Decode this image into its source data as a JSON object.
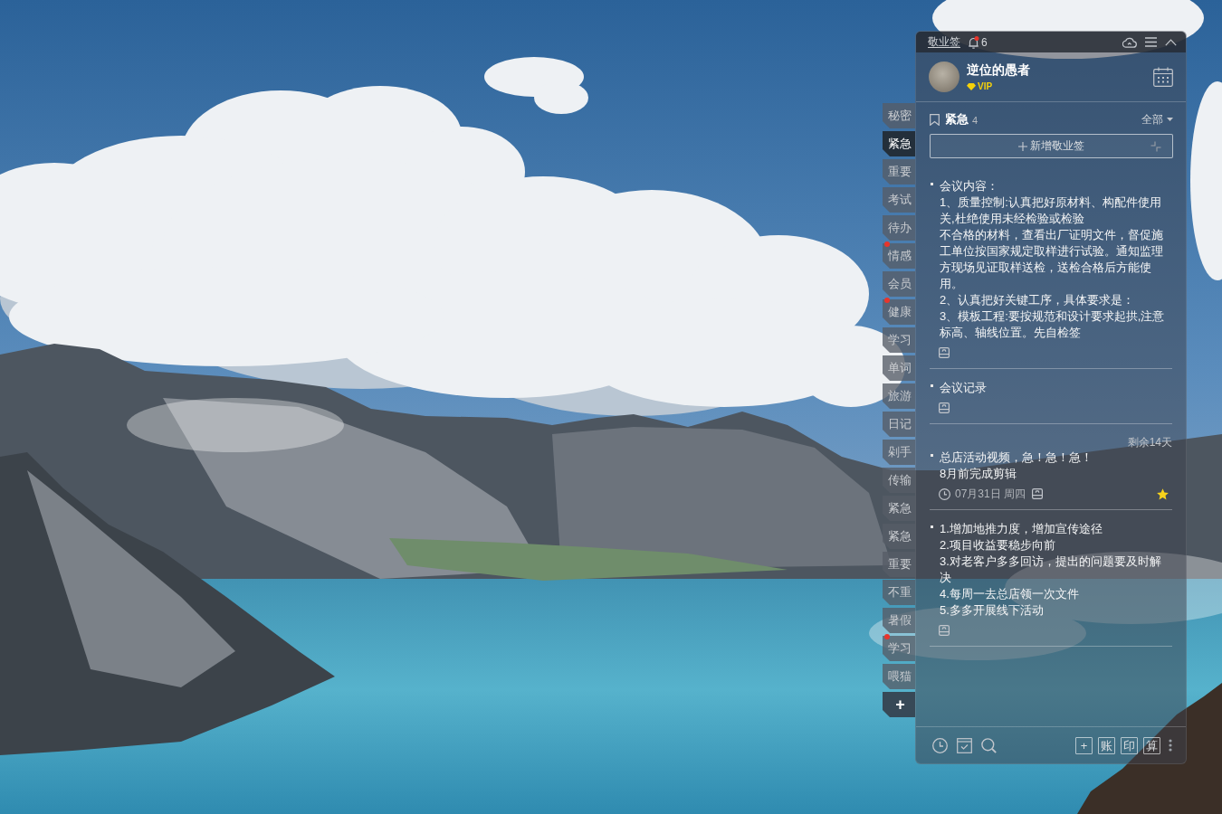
{
  "side_tabs": {
    "items": [
      {
        "label": "秘密",
        "selected": false,
        "alert": false
      },
      {
        "label": "紧急",
        "selected": true,
        "alert": false
      },
      {
        "label": "重要",
        "selected": false,
        "alert": false
      },
      {
        "label": "考试",
        "selected": false,
        "alert": false
      },
      {
        "label": "待办",
        "selected": false,
        "alert": false
      },
      {
        "label": "情感",
        "selected": false,
        "alert": true
      },
      {
        "label": "会员",
        "selected": false,
        "alert": false
      },
      {
        "label": "健康",
        "selected": false,
        "alert": true
      },
      {
        "label": "学习",
        "selected": false,
        "alert": false
      },
      {
        "label": "单词",
        "selected": false,
        "alert": false
      },
      {
        "label": "旅游",
        "selected": false,
        "alert": false
      },
      {
        "label": "日记",
        "selected": false,
        "alert": false
      },
      {
        "label": "剁手",
        "selected": false,
        "alert": false
      },
      {
        "label": "传输",
        "selected": false,
        "alert": false
      },
      {
        "label": "紧急",
        "selected": false,
        "alert": false
      },
      {
        "label": "紧急",
        "selected": false,
        "alert": false
      },
      {
        "label": "重要",
        "selected": false,
        "alert": false
      },
      {
        "label": "不重",
        "selected": false,
        "alert": false
      },
      {
        "label": "暑假",
        "selected": false,
        "alert": false
      },
      {
        "label": "学习",
        "selected": false,
        "alert": true
      },
      {
        "label": "喂猫",
        "selected": false,
        "alert": false
      }
    ],
    "add_label": "+"
  },
  "widget": {
    "title_bar": {
      "app_name": "敬业签",
      "bell_alert": true,
      "reminder_count": "6"
    },
    "profile": {
      "name": "逆位的愚者",
      "badge": "VIP"
    },
    "category": {
      "name": "紧急",
      "count": "4",
      "filter": "全部"
    },
    "new_note_button": "新增敬业签",
    "notes": [
      {
        "lines": [
          "会议内容：",
          "1、质量控制:认真把好原材料、构配件使用关,杜绝使用未经检验或检验",
          "不合格的材料，查看出厂证明文件，督促施工单位按国家规定取样进行试验。通知监理方现场见证取样送检，送检合格后方能使用。",
          "2、认真把好关键工序，具体要求是：",
          "3、模板工程:要按规范和设计要求起拱,注意标高、轴线位置。先自检签"
        ],
        "starred": false
      },
      {
        "lines": [
          "会议记录"
        ],
        "starred": false
      },
      {
        "remaining": "剩余14天",
        "lines": [
          "总店活动视频，急！急！急！",
          "8月前完成剪辑"
        ],
        "date": "07月31日 周四",
        "starred": true
      },
      {
        "lines": [
          "1.增加地推力度，增加宣传途径",
          "2.项目收益要稳步向前",
          "3.对老客户多多回访，提出的问题要及时解决",
          "4.每周一去总店领一次文件",
          "5.多多开展线下活动"
        ],
        "starred": false
      }
    ],
    "toolbar": {
      "buttons": [
        "+",
        "账",
        "印",
        "算"
      ]
    }
  }
}
